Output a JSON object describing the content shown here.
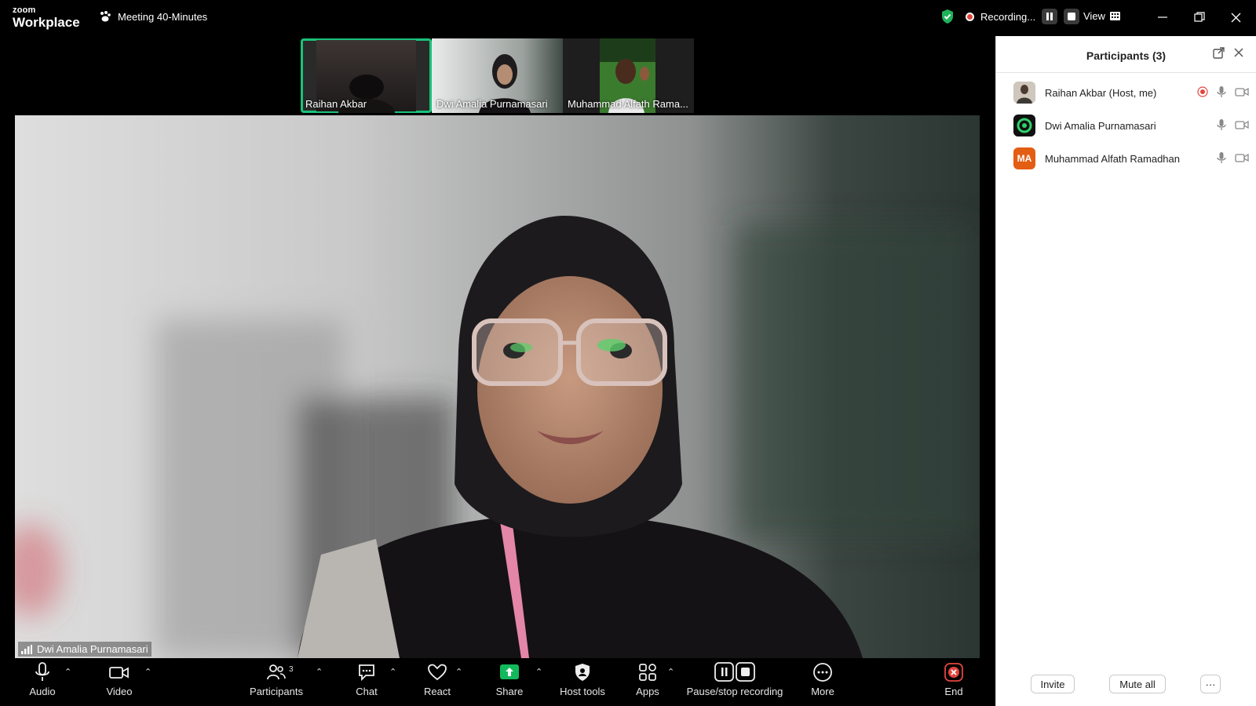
{
  "app": {
    "logo_top": "zoom",
    "logo_bottom": "Workplace",
    "meeting_title": "Meeting 40-Minutes",
    "recording_label": "Recording...",
    "view_label": "View"
  },
  "thumbnails": [
    {
      "name": "Raihan Akbar",
      "active": true
    },
    {
      "name": "Dwi Amalia Purnamasari",
      "active": false
    },
    {
      "name": "Muhammad Alfath Rama...",
      "active": false
    }
  ],
  "main_video": {
    "speaker_name": "Dwi Amalia Purnamasari"
  },
  "toolbar": {
    "audio": "Audio",
    "video": "Video",
    "participants": "Participants",
    "participants_count": "3",
    "chat": "Chat",
    "react": "React",
    "share": "Share",
    "host_tools": "Host tools",
    "apps": "Apps",
    "pause_stop": "Pause/stop recording",
    "more": "More",
    "end": "End"
  },
  "panel": {
    "title": "Participants (3)",
    "participants": [
      {
        "name": "Raihan Akbar (Host, me)",
        "avatar_text": "",
        "avatar_color": "#8a7a6a"
      },
      {
        "name": "Dwi Amalia Purnamasari",
        "avatar_text": "",
        "avatar_color": "#1a1a1a"
      },
      {
        "name": "Muhammad Alfath Ramadhan",
        "avatar_text": "MA",
        "avatar_color": "#e35d13"
      }
    ],
    "invite": "Invite",
    "mute_all": "Mute all",
    "more": "···"
  },
  "colors": {
    "accent_green": "#19c27a",
    "share_green": "#12b95c",
    "end_red": "#e0463e",
    "secure_green": "#1fb35a"
  }
}
